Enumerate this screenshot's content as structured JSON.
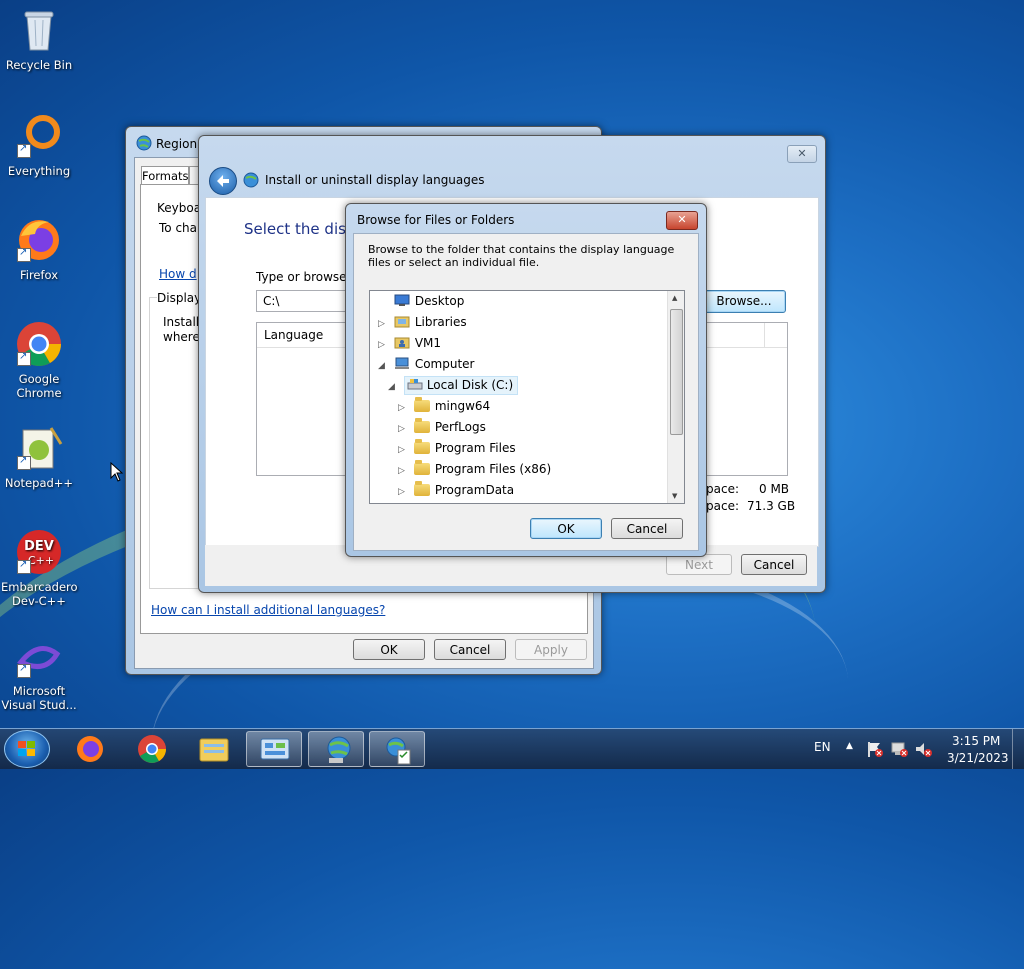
{
  "desktop": {
    "icons": [
      {
        "label": "Recycle Bin"
      },
      {
        "label": "Everything"
      },
      {
        "label": "Firefox"
      },
      {
        "label": "Google Chrome"
      },
      {
        "label": "Notepad++"
      },
      {
        "label": "Embarcadero Dev-C++"
      },
      {
        "label": "Microsoft Visual Stud..."
      }
    ]
  },
  "region_window": {
    "title": "Region a",
    "tab_formats": "Formats",
    "keyboard_group": "Keyboa",
    "keyboard_text": "To cha",
    "keyboard_link": "How d",
    "display_group": "Display",
    "display_text_1": "Install",
    "display_text_2": "where",
    "install_link": "How can I install additional languages?",
    "ok": "OK",
    "cancel": "Cancel",
    "apply": "Apply"
  },
  "install_window": {
    "title": "Install or uninstall display languages",
    "heading": "Select the disp",
    "browse_label": "Type or browse t",
    "path_value": "C:\\",
    "browse_button": "Browse...",
    "col_language": "Language",
    "space_label_1": "pace:",
    "space_value_1": "0 MB",
    "space_label_2": "pace:",
    "space_value_2": "71.3 GB",
    "next": "Next",
    "cancel": "Cancel"
  },
  "browse_dialog": {
    "title": "Browse for Files or Folders",
    "description": "Browse to the folder that contains the display language files or select an individual file.",
    "tree": [
      {
        "label": "Desktop",
        "expander": "",
        "icon": "desktop-icon"
      },
      {
        "label": "Libraries",
        "expander": "▷",
        "icon": "libraries-icon"
      },
      {
        "label": "VM1",
        "expander": "▷",
        "icon": "user-folder-icon"
      },
      {
        "label": "Computer",
        "expander": "◢",
        "icon": "computer-icon"
      },
      {
        "label": "Local Disk (C:)",
        "expander": "◢",
        "icon": "drive-icon"
      },
      {
        "label": "mingw64",
        "expander": "▷",
        "icon": "folder-icon"
      },
      {
        "label": "PerfLogs",
        "expander": "▷",
        "icon": "folder-icon"
      },
      {
        "label": "Program Files",
        "expander": "▷",
        "icon": "folder-icon"
      },
      {
        "label": "Program Files (x86)",
        "expander": "▷",
        "icon": "folder-icon"
      },
      {
        "label": "ProgramData",
        "expander": "▷",
        "icon": "folder-icon"
      }
    ],
    "ok": "OK",
    "cancel": "Cancel",
    "close": "✕"
  },
  "taskbar": {
    "lang": "EN",
    "time": "3:15 PM",
    "date": "3/21/2023"
  }
}
